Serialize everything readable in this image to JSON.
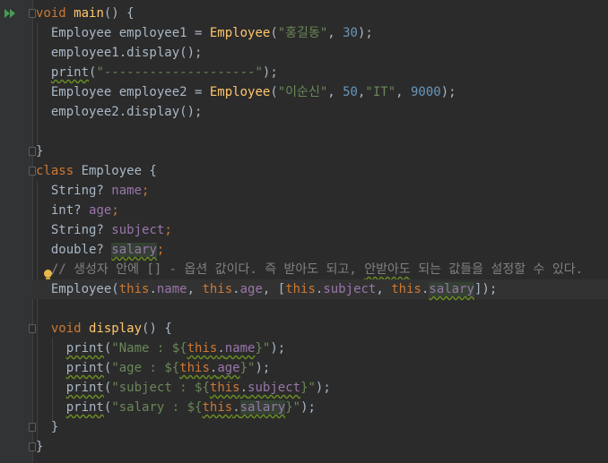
{
  "editor": {
    "lines": [
      {
        "id": "l1",
        "parts": [
          {
            "t": "void ",
            "c": "k"
          },
          {
            "t": "main",
            "c": "f"
          },
          {
            "t": "() {",
            "c": "p"
          }
        ]
      },
      {
        "id": "l2",
        "parts": [
          {
            "t": "  Employee employee1 = ",
            "c": "p"
          },
          {
            "t": "Employee",
            "c": "f"
          },
          {
            "t": "(",
            "c": "p"
          },
          {
            "t": "\"홍길동\"",
            "c": "s"
          },
          {
            "t": ", ",
            "c": "p"
          },
          {
            "t": "30",
            "c": "n"
          },
          {
            "t": ");",
            "c": "p"
          }
        ]
      },
      {
        "id": "l3",
        "parts": [
          {
            "t": "  employee1.display();",
            "c": "p"
          }
        ]
      },
      {
        "id": "l4",
        "parts": [
          {
            "t": "  ",
            "c": "p"
          },
          {
            "t": "print",
            "c": "p",
            "u": true
          },
          {
            "t": "(",
            "c": "p"
          },
          {
            "t": "\"--------------------\"",
            "c": "s"
          },
          {
            "t": ");",
            "c": "p"
          }
        ]
      },
      {
        "id": "l5",
        "parts": [
          {
            "t": "  Employee employee2 = ",
            "c": "p"
          },
          {
            "t": "Employee",
            "c": "f"
          },
          {
            "t": "(",
            "c": "p"
          },
          {
            "t": "\"이순신\"",
            "c": "s"
          },
          {
            "t": ", ",
            "c": "p"
          },
          {
            "t": "50",
            "c": "n"
          },
          {
            "t": ",",
            "c": "p"
          },
          {
            "t": "\"IT\"",
            "c": "s"
          },
          {
            "t": ", ",
            "c": "p"
          },
          {
            "t": "9000",
            "c": "n"
          },
          {
            "t": ");",
            "c": "p"
          }
        ]
      },
      {
        "id": "l6",
        "parts": [
          {
            "t": "  employee2.display();",
            "c": "p"
          }
        ]
      },
      {
        "id": "l7",
        "parts": []
      },
      {
        "id": "l8",
        "parts": [
          {
            "t": "}",
            "c": "p"
          }
        ]
      },
      {
        "id": "l9",
        "parts": [
          {
            "t": "class ",
            "c": "k"
          },
          {
            "t": "Employee {",
            "c": "p"
          }
        ]
      },
      {
        "id": "l10",
        "parts": [
          {
            "t": "  String? ",
            "c": "p"
          },
          {
            "t": "name",
            "c": "fld"
          },
          {
            "t": ";",
            "c": "k"
          }
        ]
      },
      {
        "id": "l11",
        "parts": [
          {
            "t": "  int? ",
            "c": "p"
          },
          {
            "t": "age",
            "c": "fld"
          },
          {
            "t": ";",
            "c": "k"
          }
        ]
      },
      {
        "id": "l12",
        "parts": [
          {
            "t": "  String? ",
            "c": "p"
          },
          {
            "t": "subject",
            "c": "fld"
          },
          {
            "t": ";",
            "c": "k"
          }
        ]
      },
      {
        "id": "l13",
        "parts": [
          {
            "t": "  double? ",
            "c": "p"
          },
          {
            "t": "salary",
            "c": "fld",
            "u": true,
            "h": true
          },
          {
            "t": ";",
            "c": "k"
          }
        ]
      },
      {
        "id": "l14",
        "parts": [
          {
            "t": "  // 생성자 안에 [] - 옵션 값이다. 즉 받아도 되고, ",
            "c": "c"
          },
          {
            "t": "안받아도",
            "c": "c",
            "u": true
          },
          {
            "t": " 되는 값들을 설정할 수 있다.",
            "c": "c"
          }
        ]
      },
      {
        "id": "l15",
        "current": true,
        "parts": [
          {
            "t": "  ",
            "c": "p"
          },
          {
            "t": "Employee(",
            "c": "p"
          },
          {
            "t": "this",
            "c": "k"
          },
          {
            "t": ".",
            "c": "p"
          },
          {
            "t": "name",
            "c": "fld"
          },
          {
            "t": ", ",
            "c": "p"
          },
          {
            "t": "this",
            "c": "k"
          },
          {
            "t": ".",
            "c": "p"
          },
          {
            "t": "age",
            "c": "fld"
          },
          {
            "t": ", [",
            "c": "p"
          },
          {
            "t": "this",
            "c": "k"
          },
          {
            "t": ".",
            "c": "p"
          },
          {
            "t": "subject",
            "c": "fld"
          },
          {
            "t": ", ",
            "c": "p"
          },
          {
            "t": "this",
            "c": "k"
          },
          {
            "t": ".",
            "c": "p"
          },
          {
            "t": "salary",
            "c": "fld",
            "u": true,
            "h": true
          },
          {
            "t": "]);",
            "c": "p"
          }
        ]
      },
      {
        "id": "l16",
        "parts": []
      },
      {
        "id": "l17",
        "parts": [
          {
            "t": "  ",
            "c": "p"
          },
          {
            "t": "void ",
            "c": "k"
          },
          {
            "t": "display",
            "c": "f"
          },
          {
            "t": "() {",
            "c": "p"
          }
        ]
      },
      {
        "id": "l18",
        "parts": [
          {
            "t": "    ",
            "c": "p"
          },
          {
            "t": "print",
            "c": "p",
            "u": true
          },
          {
            "t": "(",
            "c": "p"
          },
          {
            "t": "\"Name : ${",
            "c": "s"
          },
          {
            "t": "this",
            "c": "k",
            "u": true
          },
          {
            "t": ".",
            "c": "p",
            "u": true
          },
          {
            "t": "name",
            "c": "fld",
            "u": true
          },
          {
            "t": "}\"",
            "c": "s"
          },
          {
            "t": ");",
            "c": "p"
          }
        ]
      },
      {
        "id": "l19",
        "parts": [
          {
            "t": "    ",
            "c": "p"
          },
          {
            "t": "print",
            "c": "p",
            "u": true
          },
          {
            "t": "(",
            "c": "p"
          },
          {
            "t": "\"age : ${",
            "c": "s"
          },
          {
            "t": "this",
            "c": "k",
            "u": true
          },
          {
            "t": ".",
            "c": "p",
            "u": true
          },
          {
            "t": "age",
            "c": "fld",
            "u": true
          },
          {
            "t": "}\"",
            "c": "s"
          },
          {
            "t": ");",
            "c": "p"
          }
        ]
      },
      {
        "id": "l20",
        "parts": [
          {
            "t": "    ",
            "c": "p"
          },
          {
            "t": "print",
            "c": "p",
            "u": true
          },
          {
            "t": "(",
            "c": "p"
          },
          {
            "t": "\"subject : ${",
            "c": "s"
          },
          {
            "t": "this",
            "c": "k",
            "u": true
          },
          {
            "t": ".",
            "c": "p",
            "u": true
          },
          {
            "t": "subject",
            "c": "fld",
            "u": true
          },
          {
            "t": "}\"",
            "c": "s"
          },
          {
            "t": ");",
            "c": "p"
          }
        ]
      },
      {
        "id": "l21",
        "parts": [
          {
            "t": "    ",
            "c": "p"
          },
          {
            "t": "print",
            "c": "p",
            "u": true
          },
          {
            "t": "(",
            "c": "p"
          },
          {
            "t": "\"salary : ${",
            "c": "s"
          },
          {
            "t": "this",
            "c": "k",
            "u": true
          },
          {
            "t": ".",
            "c": "p",
            "u": true
          },
          {
            "t": "salary",
            "c": "fld",
            "u": true,
            "h": true
          },
          {
            "t": "}\"",
            "c": "s"
          },
          {
            "t": ");",
            "c": "p"
          }
        ]
      },
      {
        "id": "l22",
        "parts": [
          {
            "t": "  }",
            "c": "p"
          }
        ]
      },
      {
        "id": "l23",
        "parts": [
          {
            "t": "}",
            "c": "p"
          }
        ]
      }
    ]
  },
  "gutter": {
    "run_icon": "run-double-arrow-icon",
    "bulb_icon": "intention-bulb-icon"
  },
  "colors": {
    "background": "#2b2b2b",
    "keyword": "#cc7832",
    "function": "#ffc66d",
    "string": "#6a8759",
    "number": "#6897bb",
    "field": "#9876aa",
    "comment": "#808080",
    "text": "#a9b7c6"
  }
}
